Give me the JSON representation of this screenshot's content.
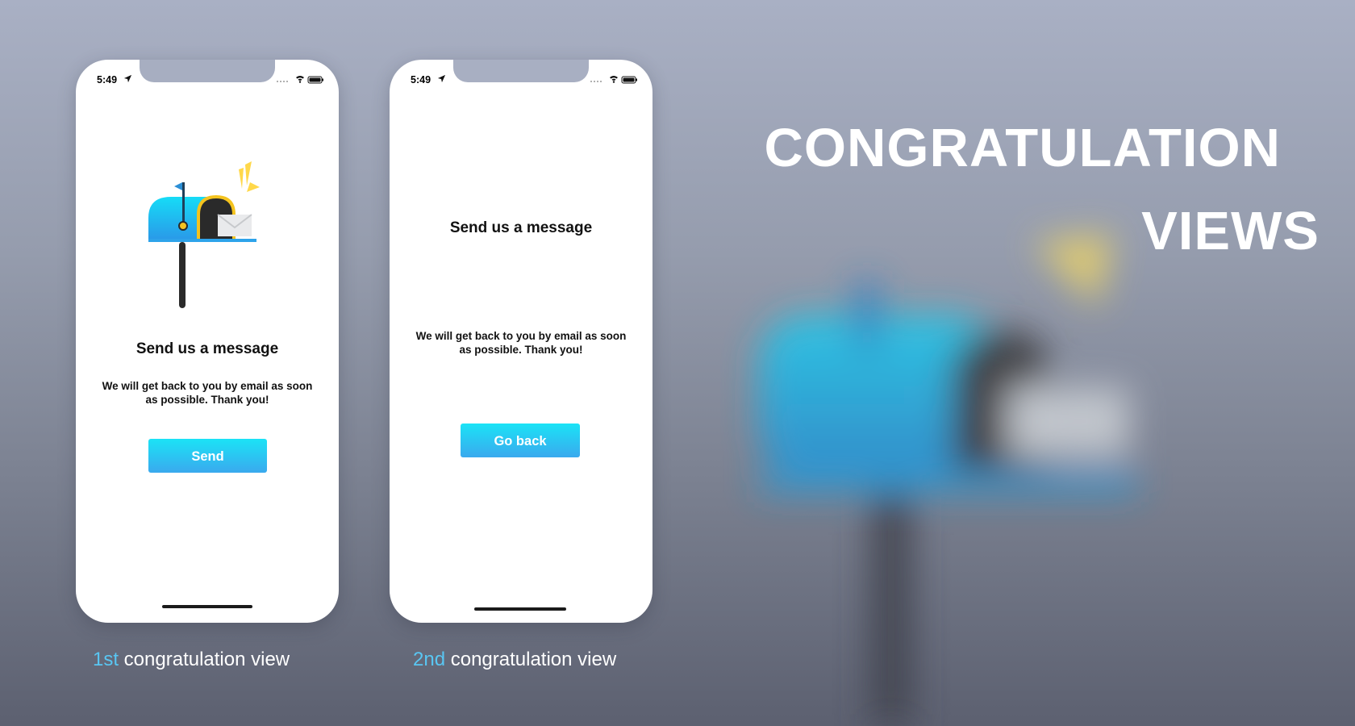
{
  "headline": {
    "line1": "CONGRATULATION",
    "line2": "VIEWS"
  },
  "phones": [
    {
      "status_time": "5:49",
      "title": "Send us a message",
      "message": "We will get back to you by  email as soon as possible. Thank you!",
      "button_label": "Send"
    },
    {
      "status_time": "5:49",
      "title": "Send us a message",
      "message": "We will get back to you by  email as soon as possible. Thank you!",
      "button_label": "Go back"
    }
  ],
  "captions": [
    {
      "ordinal": "1st",
      "text": " congratulation view"
    },
    {
      "ordinal": "2nd",
      "text": " congratulation view"
    }
  ],
  "colors": {
    "accent": "#59c6f2",
    "button_top": "#1be3f6",
    "button_bottom": "#3aa9ee",
    "mailbox_blue": "#1ec9f5",
    "flag_yellow": "#ffd84a"
  },
  "icons": [
    "location-arrow-icon",
    "signal-dots-icon",
    "wifi-icon",
    "battery-icon",
    "mailbox-illustration"
  ]
}
